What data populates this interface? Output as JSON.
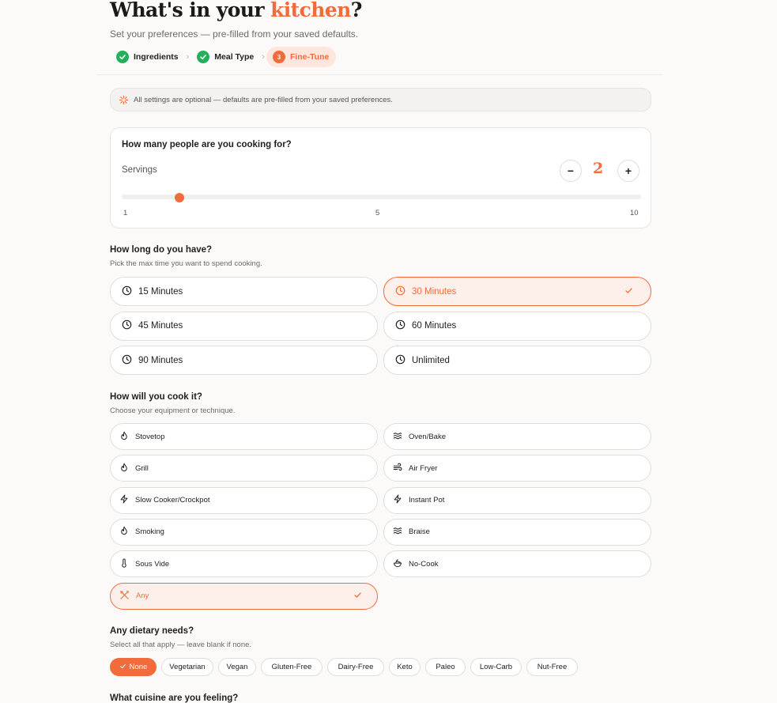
{
  "header": {
    "title_prefix": "What's in your ",
    "title_accent": "kitchen",
    "title_suffix": "?",
    "subtitle": "Set your preferences — pre-filled from your saved defaults."
  },
  "steps": [
    {
      "label": "Ingredients",
      "state": "done"
    },
    {
      "label": "Meal Type",
      "state": "done"
    },
    {
      "label": "Fine-Tune",
      "state": "current",
      "number": "3"
    }
  ],
  "notice": "All settings are optional — defaults are pre-filled from your saved preferences.",
  "servings": {
    "question": "How many people are you cooking for?",
    "label": "Servings",
    "value": "2",
    "minus": "−",
    "plus": "+",
    "min": 1,
    "max": 10,
    "ticks": [
      "1",
      "5",
      "10"
    ]
  },
  "time": {
    "heading": "How long do you have?",
    "sub": "Pick the max time you want to spend cooking.",
    "options": [
      {
        "label": "15 Minutes",
        "selected": false
      },
      {
        "label": "30 Minutes",
        "selected": true
      },
      {
        "label": "45 Minutes",
        "selected": false
      },
      {
        "label": "60 Minutes",
        "selected": false
      },
      {
        "label": "90 Minutes",
        "selected": false
      },
      {
        "label": "Unlimited",
        "selected": false
      }
    ]
  },
  "equipment": {
    "heading": "How will you cook it?",
    "sub": "Choose your equipment or technique.",
    "options": [
      {
        "label": "Stovetop",
        "icon": "flame-icon",
        "selected": false
      },
      {
        "label": "Oven/Bake",
        "icon": "heat-waves-icon",
        "selected": false
      },
      {
        "label": "Grill",
        "icon": "flame-icon",
        "selected": false
      },
      {
        "label": "Air Fryer",
        "icon": "wind-icon",
        "selected": false
      },
      {
        "label": "Slow Cooker/Crockpot",
        "icon": "zap-icon",
        "selected": false
      },
      {
        "label": "Instant Pot",
        "icon": "zap-icon",
        "selected": false
      },
      {
        "label": "Smoking",
        "icon": "flame-icon",
        "selected": false
      },
      {
        "label": "Braise",
        "icon": "heat-waves-icon",
        "selected": false
      },
      {
        "label": "Sous Vide",
        "icon": "thermometer-icon",
        "selected": false
      },
      {
        "label": "No-Cook",
        "icon": "salad-icon",
        "selected": false
      },
      {
        "label": "Any",
        "icon": "utensils-crossed-icon",
        "selected": true
      }
    ]
  },
  "diet": {
    "heading": "Any dietary needs?",
    "sub": "Select all that apply — leave blank if none.",
    "chips": [
      {
        "label": "None",
        "selected": true
      },
      {
        "label": "Vegetarian",
        "selected": false
      },
      {
        "label": "Vegan",
        "selected": false
      },
      {
        "label": "Gluten-Free",
        "selected": false
      },
      {
        "label": "Dairy-Free",
        "selected": false
      },
      {
        "label": "Keto",
        "selected": false
      },
      {
        "label": "Paleo",
        "selected": false
      },
      {
        "label": "Low-Carb",
        "selected": false
      },
      {
        "label": "Nut-Free",
        "selected": false
      }
    ]
  },
  "cuisine": {
    "heading": "What cuisine are you feeling?"
  },
  "colors": {
    "accent": "#f26b3a",
    "accent_bg": "#fdf0ea",
    "done": "#23b05a",
    "page_bg": "#fbfaf8"
  }
}
